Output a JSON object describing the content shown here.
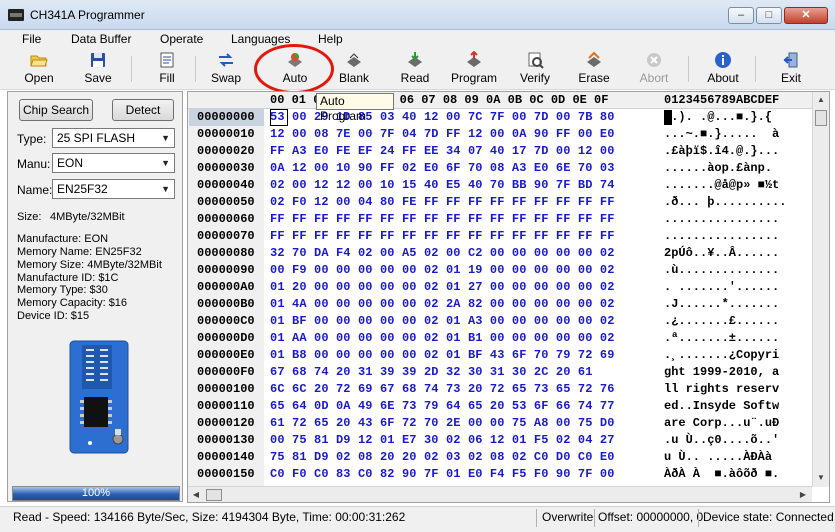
{
  "window": {
    "title": "CH341A Programmer",
    "min_label": "–",
    "max_label": "□",
    "close_label": "✕"
  },
  "menu": {
    "file": "File",
    "data_buffer": "Data Buffer",
    "operate": "Operate",
    "languages": "Languages",
    "help": "Help"
  },
  "toolbar": {
    "open": "Open",
    "save": "Save",
    "fill": "Fill",
    "swap": "Swap",
    "auto": "Auto",
    "blank": "Blank",
    "read": "Read",
    "program": "Program",
    "verify": "Verify",
    "erase": "Erase",
    "abort": "Abort",
    "about": "About",
    "exit": "Exit"
  },
  "tooltip": "Auto Program",
  "chip": {
    "search_button": "Chip Search",
    "detect_button": "Detect",
    "type_label": "Type:",
    "type_value": "25 SPI FLASH",
    "manu_label": "Manu:",
    "manu_value": "EON",
    "name_label": "Name:",
    "name_value": "EN25F32",
    "size_label": "Size:",
    "size_value": "4MByte/32MBit",
    "info": [
      "Manufacture: EON",
      "Memory Name: EN25F32",
      "Memory Size: 4MByte/32MBit",
      "Manufacture ID: $1C",
      "Memory Type: $30",
      "Memory Capacity: $16",
      "Device ID: $15"
    ]
  },
  "progress": {
    "fraction": 1.0,
    "label": "100%"
  },
  "hex": {
    "header_cols": "00 01 02 03 04 05 06 07 08 09 0A 0B 0C 0D 0E 0F",
    "header_ascii": "0123456789ABCDEF",
    "rows": [
      {
        "addr": "00000000",
        "bytes": "53 00 29 1D 85 03 40 12 00 7C 7F 00 7D 00 7B 80",
        "ascii": "S.). .@...■.}.{ "
      },
      {
        "addr": "00000010",
        "bytes": "12 00 08 7E 00 7F 04 7D FF 12 00 0A 90 FF 00 E0",
        "ascii": "...~.■.}.....  à"
      },
      {
        "addr": "00000020",
        "bytes": "FF A3 E0 FE EF 24 FF EE 34 07 40 17 7D 00 12 00",
        "ascii": ".£àþï$.î4.@.}..."
      },
      {
        "addr": "00000030",
        "bytes": "0A 12 00 10 90 FF 02 E0 6F 70 08 A3 E0 6E 70 03",
        "ascii": "......àop.£ànp."
      },
      {
        "addr": "00000040",
        "bytes": "02 00 12 12 00 10 15 40 E5 40 70 BB 90 7F BD 74",
        "ascii": ".......@å@p» ■½t"
      },
      {
        "addr": "00000050",
        "bytes": "02 F0 12 00 04 80 FE FF FF FF FF FF FF FF FF FF",
        "ascii": ".ð... þ.........."
      },
      {
        "addr": "00000060",
        "bytes": "FF FF FF FF FF FF FF FF FF FF FF FF FF FF FF FF",
        "ascii": "................"
      },
      {
        "addr": "00000070",
        "bytes": "FF FF FF FF FF FF FF FF FF FF FF FF FF FF FF FF",
        "ascii": "................"
      },
      {
        "addr": "00000080",
        "bytes": "32 70 DA F4 02 00 A5 02 00 C2 00 00 00 00 00 02",
        "ascii": "2pÚô..¥..Â......"
      },
      {
        "addr": "00000090",
        "bytes": "00 F9 00 00 00 00 00 02 01 19 00 00 00 00 00 02",
        "ascii": ".ù.............."
      },
      {
        "addr": "000000A0",
        "bytes": "01 20 00 00 00 00 00 02 01 27 00 00 00 00 00 02",
        "ascii": ". .......'......"
      },
      {
        "addr": "000000B0",
        "bytes": "01 4A 00 00 00 00 00 02 2A 82 00 00 00 00 00 02",
        "ascii": ".J......*......."
      },
      {
        "addr": "000000C0",
        "bytes": "01 BF 00 00 00 00 00 02 01 A3 00 00 00 00 00 02",
        "ascii": ".¿.......£......"
      },
      {
        "addr": "000000D0",
        "bytes": "01 AA 00 00 00 00 00 02 01 B1 00 00 00 00 00 02",
        "ascii": ".ª.......±......"
      },
      {
        "addr": "000000E0",
        "bytes": "01 B8 00 00 00 00 00 02 01 BF 43 6F 70 79 72 69",
        "ascii": ".¸.......¿Copyri"
      },
      {
        "addr": "000000F0",
        "bytes": "67 68 74 20 31 39 39 2D 32 30 31 30 2C 20 61",
        "ascii": "ght 1999-2010, a"
      },
      {
        "addr": "00000100",
        "bytes": "6C 6C 20 72 69 67 68 74 73 20 72 65 73 65 72 76",
        "ascii": "ll rights reserv"
      },
      {
        "addr": "00000110",
        "bytes": "65 64 0D 0A 49 6E 73 79 64 65 20 53 6F 66 74 77",
        "ascii": "ed..Insyde Softw"
      },
      {
        "addr": "00000120",
        "bytes": "61 72 65 20 43 6F 72 70 2E 00 00 75 A8 00 75 D0",
        "ascii": "are Corp...u¨.uÐ"
      },
      {
        "addr": "00000130",
        "bytes": "00 75 81 D9 12 01 E7 30 02 06 12 01 F5 02 04 27",
        "ascii": ".u Ù..ç0....õ..'"
      },
      {
        "addr": "00000140",
        "bytes": "75 81 D9 02 08 20 20 02 03 02 08 02 C0 D0 C0 E0",
        "ascii": "u Ù.. .....ÀÐÀà"
      },
      {
        "addr": "00000150",
        "bytes": "C0 F0 C0 83 C0 82 90 7F 01 E0 F4 F5 F0 90 7F 00",
        "ascii": "ÀðÀ À  ■.àôõð ■."
      }
    ]
  },
  "status": {
    "speed": "Read - Speed: 134166 Byte/Sec, Size: 4194304 Byte, Time: 00:00:31:262",
    "mode": "Overwrite",
    "offset": "Offset: 00000000, 0",
    "device": "Device state: Connected"
  },
  "icons": {
    "open": "folder-open-icon",
    "save": "floppy-icon",
    "fill": "fill-icon",
    "swap": "swap-arrows-icon",
    "auto": "auto-program-icon",
    "blank": "blank-check-icon",
    "read": "read-chip-icon",
    "program": "program-chip-icon",
    "verify": "verify-icon",
    "erase": "erase-icon",
    "abort": "abort-icon",
    "about": "info-icon",
    "exit": "exit-icon"
  },
  "colors": {
    "hex_bytes": "#1a1acc",
    "highlight_ring": "#e3170d",
    "progress": "#2b5fb0",
    "tooltip_bg": "#fffbe7"
  }
}
